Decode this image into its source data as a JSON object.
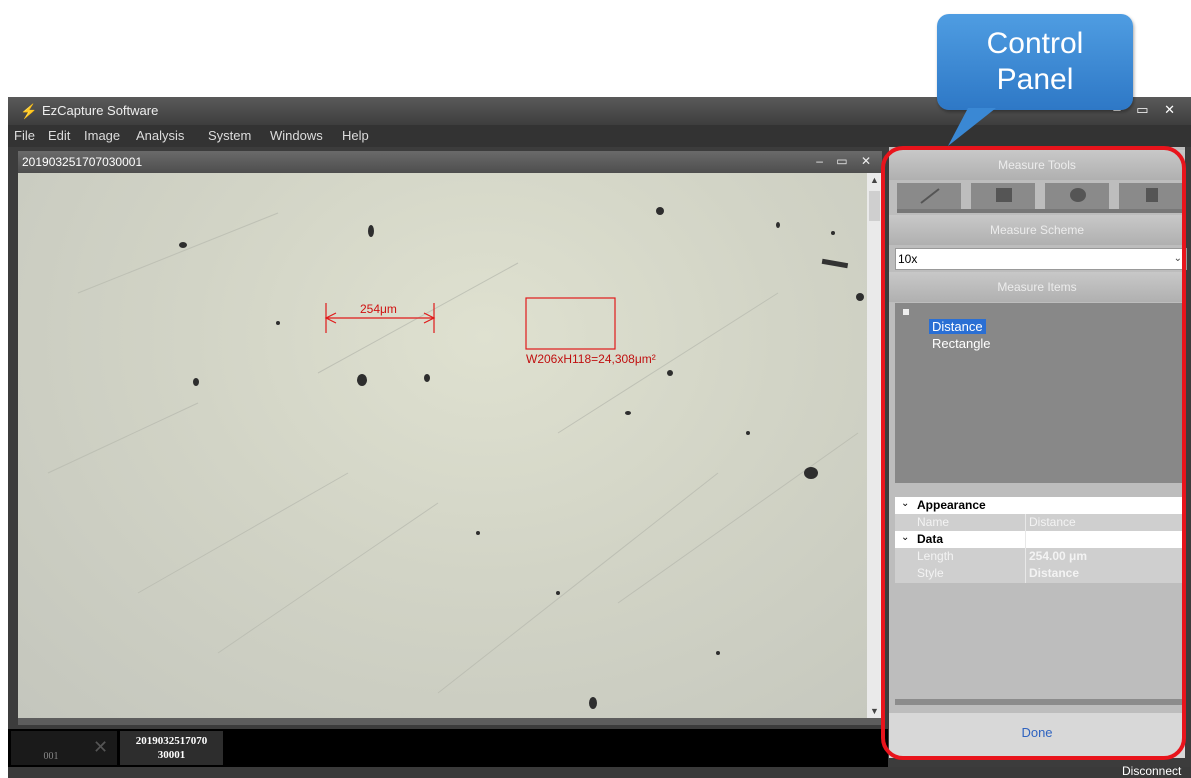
{
  "app": {
    "title": "EzCapture Software",
    "window_controls": "– ▭ ✕"
  },
  "menu": [
    "File",
    "Edit",
    "Image",
    "Analysis",
    "System",
    "Windows",
    "Help"
  ],
  "image_window": {
    "title": "201903251707030001",
    "controls": "– ▭ ✕"
  },
  "annotations": {
    "distance_label": "254μm",
    "rectangle_label": "W206xH118=24,308μm²"
  },
  "thumbnails": [
    {
      "label": "001"
    },
    {
      "label_line1": "2019032517070",
      "label_line2": "30001"
    }
  ],
  "panel": {
    "measure_tools_title": "Measure Tools",
    "tools": [
      "line-tool-icon",
      "rectangle-tool-icon",
      "ellipse-tool-icon",
      "lock-tool-icon"
    ],
    "measure_scheme_title": "Measure Scheme",
    "scheme_value": "10x",
    "measure_items_title": "Measure Items",
    "items": [
      "Distance",
      "Rectangle"
    ],
    "properties": {
      "appearance_label": "Appearance",
      "name_key": "Name",
      "name_value": "Distance",
      "data_label": "Data",
      "length_key": "Length",
      "length_value": "254.00 μm",
      "style_key": "Style",
      "style_value": "Distance"
    },
    "done_label": "Done"
  },
  "callout": {
    "line1": "Control",
    "line2": "Panel"
  },
  "status": {
    "connection": "Disconnect"
  },
  "colors": {
    "highlight_red": "#e8141c",
    "callout_blue": "#3a88d4",
    "selected_item": "#2a6fd4",
    "done_text": "#2f63c0"
  }
}
